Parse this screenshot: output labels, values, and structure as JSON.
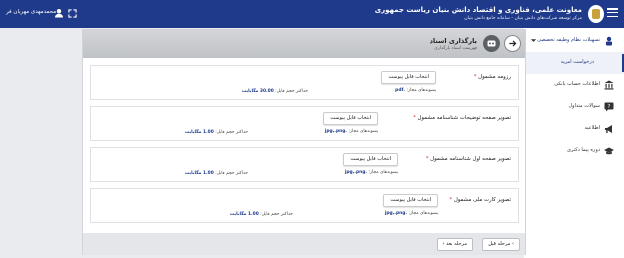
{
  "header": {
    "title": "معاونت علمی، فناوری و اقتصاد دانش بنیان ریاست جمهوری",
    "subtitle": "مرکز توسعه شرکت‌های دانش بنیان - سامانه جامع دانش بنیان",
    "user_name": "محمدمهدی مهربان فر"
  },
  "sidebar": {
    "items": [
      {
        "label": "تسهیلات نظام وظیفه تخصصی",
        "icon": "soldier-icon"
      },
      {
        "label": "درخواست امریه",
        "icon": ""
      },
      {
        "label": "اطلاعات حساب بانکی",
        "icon": "bank-icon"
      },
      {
        "label": "سوالات متداول",
        "icon": "faq-icon"
      },
      {
        "label": "اطلاعیه",
        "icon": "megaphone-icon"
      },
      {
        "label": "دوره پیما دکتری",
        "icon": "graduation-cap-icon"
      }
    ]
  },
  "page": {
    "title": "بارگذاری اسناد",
    "subtitle": "فهرست اسناد بارگذاری"
  },
  "uploads": [
    {
      "label": "رزومه مشمول",
      "button": "انتخاب فایل پیوست",
      "formats_label": "پسوندهای مجاز:",
      "formats": ".pdf",
      "max_label": "حداکثر حجم فایل:",
      "max_value": "30.00 مگابایت"
    },
    {
      "label": "تصویر صفحه توضیحات شناسنامه مشمول",
      "button": "انتخاب فایل پیوست",
      "formats_label": "پسوندهای مجاز:",
      "formats": ".jpg,.png",
      "max_label": "حداکثر حجم فایل:",
      "max_value": "1.00 مگابایت"
    },
    {
      "label": "تصویر صفحه اول شناسنامه مشمول",
      "button": "انتخاب فایل پیوست",
      "formats_label": "پسوندهای مجاز:",
      "formats": ".jpg,.png",
      "max_label": "حداکثر حجم فایل:",
      "max_value": "1.00 مگابایت"
    },
    {
      "label": "تصویر کارت ملی مشمول",
      "button": "انتخاب فایل پیوست",
      "formats_label": "پسوندهای مجاز:",
      "formats": ".jpg,.png",
      "max_label": "حداکثر حجم فایل:",
      "max_value": "1.00 مگابایت"
    }
  ],
  "footer": {
    "prev_label": "مرحله قبل",
    "next_label": "مرحله بعد"
  },
  "colors": {
    "brand": "#1f3a8a",
    "required": "#cc3333"
  }
}
